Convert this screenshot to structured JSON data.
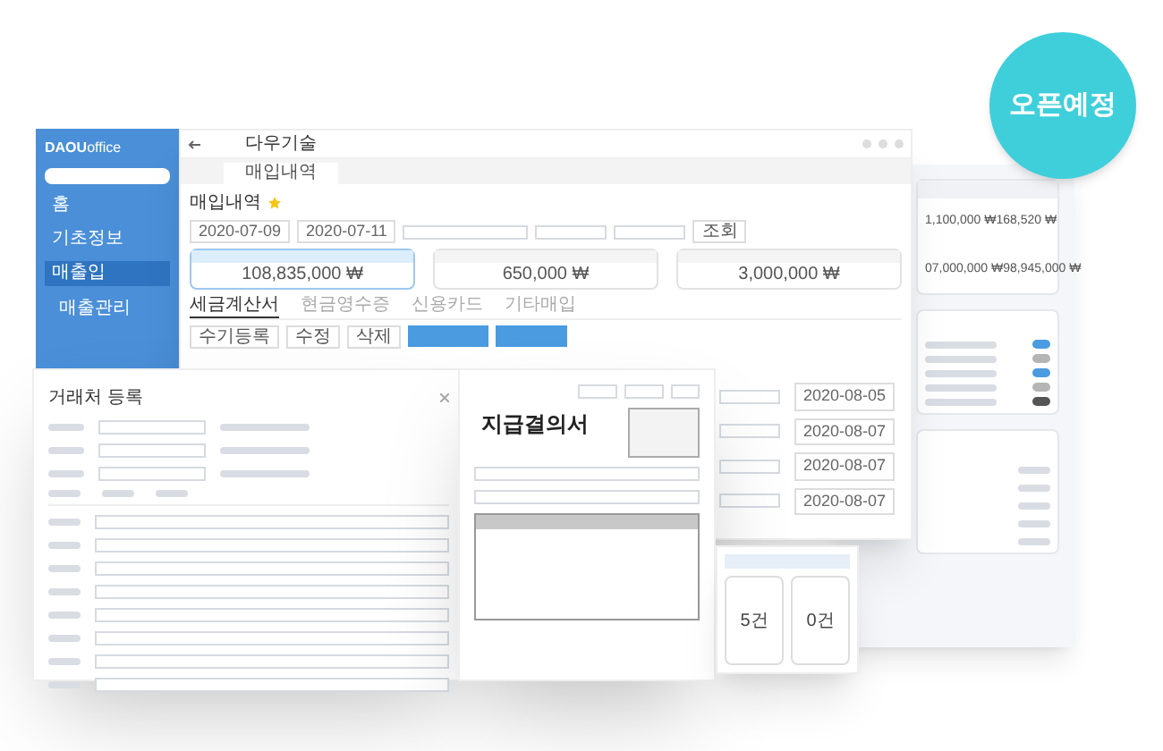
{
  "badge": {
    "label": "오픈예정"
  },
  "back_panel": {
    "amount_rows": [
      {
        "column_1": "1,100,000 ₩",
        "column_2": "168,520 ₩"
      },
      {
        "column_1": "07,000,000 ₩",
        "column_2": "98,945,000 ₩"
      }
    ],
    "status_tags": [
      {
        "color": "#4a9be0"
      },
      {
        "color": "#b5b5b5"
      },
      {
        "color": "#4a9be0"
      },
      {
        "color": "#b5b5b5"
      },
      {
        "color": "#555555"
      }
    ]
  },
  "sidebar": {
    "logo": {
      "brand": "DAOU",
      "product": "office"
    },
    "items": [
      {
        "label": "홈",
        "selected": false
      },
      {
        "label": "기초정보",
        "selected": false
      },
      {
        "label": "매출입",
        "selected": true
      }
    ],
    "section": "매출관리"
  },
  "window": {
    "title": "다우기술",
    "tab": "매입내역",
    "page_title": "매입내역",
    "date_from": "2020-07-09",
    "date_to": "2020-07-11",
    "search_button": "조회",
    "summary_cards": [
      {
        "value": "108,835,000 ₩",
        "selected": true
      },
      {
        "value": "650,000 ₩",
        "selected": false
      },
      {
        "value": "3,000,000 ₩",
        "selected": false
      }
    ],
    "tabs": [
      {
        "label": "세금계산서",
        "selected": true
      },
      {
        "label": "현금영수증",
        "selected": false
      },
      {
        "label": "신용카드",
        "selected": false
      },
      {
        "label": "기타매입",
        "selected": false
      }
    ],
    "toolbar": [
      "수기등록",
      "수정",
      "삭제"
    ],
    "row_dates": [
      "2020-08-05",
      "2020-08-07",
      "2020-08-07",
      "2020-08-07"
    ]
  },
  "dialog": {
    "title": "거래처 등록"
  },
  "document": {
    "title": "지급결의서"
  },
  "summary_panel": {
    "counts": [
      "5건",
      "0건"
    ]
  }
}
